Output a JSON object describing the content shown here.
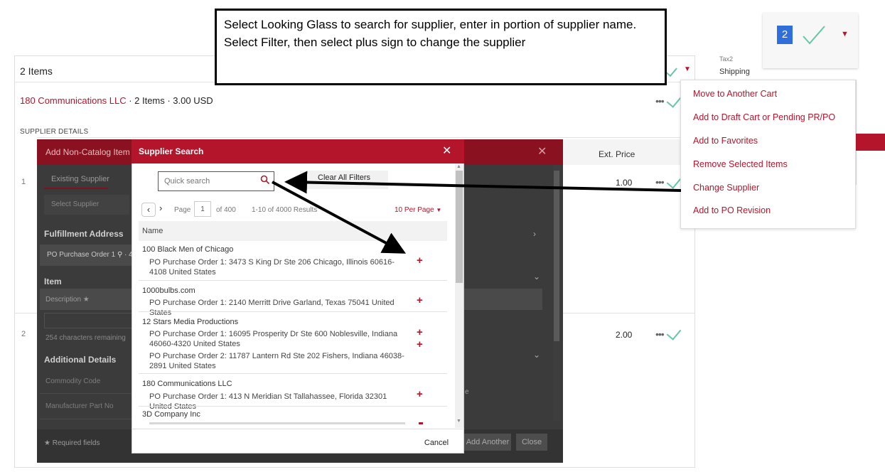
{
  "callout": "Select Looking Glass to search for supplier, enter in portion of supplier name. Select Filter, then select plus sign to change the supplier",
  "cart": {
    "items_title": "2 Items",
    "supplier_name": "180 Communications LLC",
    "supplier_summary": " · 2 Items  · 3.00 USD",
    "supplier_details_label": "SUPPLIER DETAILS",
    "ext_price_header": "Ext. Price",
    "rows": [
      {
        "num": "1",
        "price": "1.00"
      },
      {
        "num": "2",
        "price": "2.00"
      }
    ],
    "more_icon": "ellipsis-icon",
    "check_color": "#68c6a3"
  },
  "non_catalog": {
    "title": "Add Non-Catalog Item",
    "tab_existing": "Existing Supplier",
    "select_supplier": "Select Supplier",
    "fulfillment_label": "Fulfillment Address",
    "fulfillment_value": "PO Purchase Order 1",
    "fulfillment_value_tail": "· 41",
    "item_label": "Item",
    "description_label": "Description ★",
    "chars_remaining": "254 characters remaining",
    "additional_details": "Additional Details",
    "commodity_code": "Commodity Code",
    "manufacturer_part": "Manufacturer Part No",
    "required_fields": "★ Required fields",
    "add_another": "Add Another",
    "close": "Close",
    "partial_text": "e"
  },
  "supplier_search": {
    "title": "Supplier Search",
    "search_placeholder": "Quick search",
    "clear_filters": "Clear All Filters",
    "page_label": "Page",
    "page_value": "1",
    "page_of": "of 400",
    "results": "1-10 of 4000 Results",
    "per_page": "10 Per Page",
    "column_name": "Name",
    "suppliers": [
      {
        "name": "100 Black Men of Chicago",
        "addresses": [
          "PO Purchase Order 1: 3473 S King Dr Ste 206 Chicago, Illinois 60616-4108 United States"
        ]
      },
      {
        "name": "1000bulbs.com",
        "addresses": [
          "PO Purchase Order 1: 2140 Merritt Drive Garland, Texas 75041 United States"
        ]
      },
      {
        "name": "12 Stars Media Productions",
        "addresses": [
          "PO Purchase Order 1: 16095 Prosperity Dr Ste 600 Noblesville, Indiana 46060-4320 United States",
          "PO Purchase Order 2: 11787 Lantern Rd Ste 202 Fishers, Indiana 46038-2891 United States"
        ]
      },
      {
        "name": "180 Communications LLC",
        "addresses": [
          "PO Purchase Order 1: 413 N Meridian St Tallahassee, Florida 32301 United States"
        ]
      },
      {
        "name": "3D Company Inc",
        "addresses": []
      }
    ],
    "cancel": "Cancel",
    "accent": "#b5152b"
  },
  "menu": {
    "items": [
      "Move to Another Cart",
      "Add to Draft Cart or Pending PR/PO",
      "Add to Favorites",
      "Remove Selected Items",
      "Change Supplier",
      "Add to PO Revision"
    ],
    "peek_tax": "Tax2",
    "peek_shipping": "Shipping"
  },
  "inset": {
    "badge": "2"
  }
}
